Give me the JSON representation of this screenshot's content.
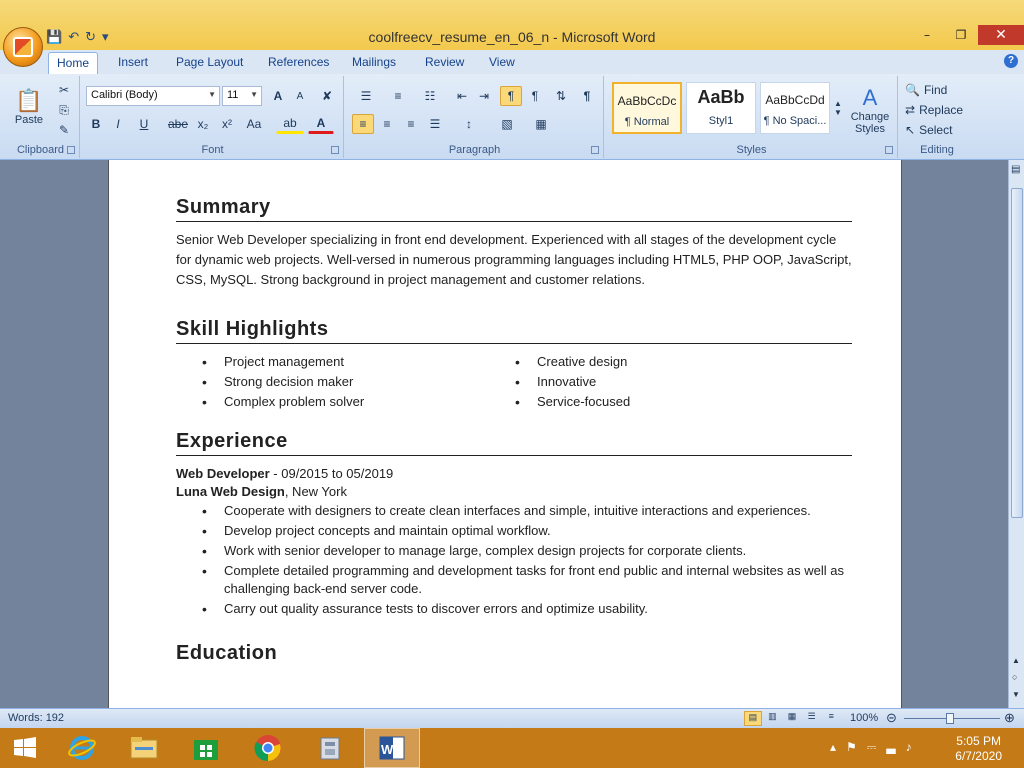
{
  "window": {
    "title": "coolfreecv_resume_en_06_n - Microsoft Word"
  },
  "tabs": [
    "Home",
    "Insert",
    "Page Layout",
    "References",
    "Mailings",
    "Review",
    "View"
  ],
  "ribbon": {
    "clipboard": {
      "paste": "Paste",
      "label": "Clipboard"
    },
    "font": {
      "name": "Calibri (Body)",
      "size": "11",
      "label": "Font",
      "bold": "B",
      "italic": "I",
      "underline": "U",
      "strike": "abe",
      "subscript": "x₂",
      "superscript": "x²",
      "case": "Aa",
      "grow": "A",
      "shrink": "A"
    },
    "paragraph": {
      "label": "Paragraph"
    },
    "styles": {
      "label": "Styles",
      "items": [
        {
          "sample": "AaBbCcDc",
          "name": "¶ Normal"
        },
        {
          "sample": "AaBb",
          "name": "Styl1"
        },
        {
          "sample": "AaBbCcDd",
          "name": "¶ No Spaci..."
        }
      ],
      "change": "Change Styles"
    },
    "editing": {
      "find": "Find",
      "replace": "Replace",
      "select": "Select",
      "label": "Editing"
    }
  },
  "document": {
    "summary": {
      "heading": "Summary",
      "text": "Senior Web Developer specializing in front end development. Experienced with all stages of the development cycle for dynamic web projects. Well-versed in numerous programming languages including HTML5, PHP OOP, JavaScript, CSS, MySQL. Strong background in project management and customer relations."
    },
    "skills": {
      "heading": "Skill Highlights",
      "left": [
        "Project management",
        "Strong decision maker",
        "Complex problem solver"
      ],
      "right": [
        "Creative design",
        "Innovative",
        "Service-focused"
      ]
    },
    "experience": {
      "heading": "Experience",
      "job_title": "Web Developer",
      "dates": " - 09/2015 to 05/2019",
      "company": "Luna Web Design",
      "location": ", New York",
      "bullets": [
        "Cooperate with designers to create clean interfaces and simple, intuitive interactions and experiences.",
        "Develop project concepts and maintain optimal workflow.",
        "Work with senior developer to manage large, complex design projects for corporate clients.",
        "Complete detailed programming and development tasks for front end public and internal websites as well as challenging back-end server code.",
        "Carry out quality assurance tests to discover errors and optimize usability."
      ]
    },
    "next_heading": "Education"
  },
  "status": {
    "words": "Words: 192",
    "zoom": "100%"
  },
  "taskbar": {
    "time": "5:05 PM",
    "date": "6/7/2020"
  },
  "colors": {
    "title_bar": "#f3c94d",
    "taskbar": "#c47a17",
    "ribbon": "#c9dbf2",
    "doc_bg": "#73839b"
  }
}
